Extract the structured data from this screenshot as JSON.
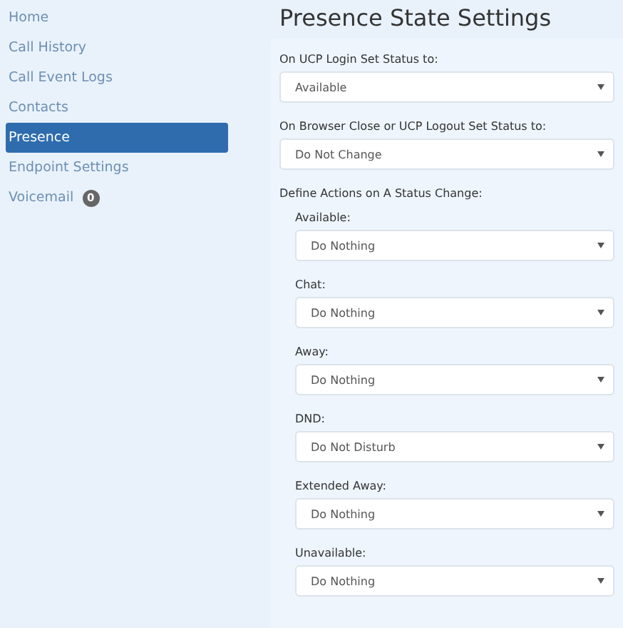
{
  "sidebar": {
    "items": [
      {
        "label": "Home",
        "selected": false
      },
      {
        "label": "Call History",
        "selected": false
      },
      {
        "label": "Call Event Logs",
        "selected": false
      },
      {
        "label": "Contacts",
        "selected": false
      },
      {
        "label": "Presence",
        "selected": true
      },
      {
        "label": "Endpoint Settings",
        "selected": false
      },
      {
        "label": "Voicemail",
        "selected": false,
        "badge": "0"
      }
    ]
  },
  "page_title": "Presence State Settings",
  "settings": [
    {
      "label": "On UCP Login Set Status to:",
      "value": "Available"
    },
    {
      "label": "On Browser Close or UCP Logout Set Status to:",
      "value": "Do Not Change"
    }
  ],
  "actions": {
    "heading": "Define Actions on A Status Change:",
    "items": [
      {
        "label": "Available:",
        "value": "Do Nothing"
      },
      {
        "label": "Chat:",
        "value": "Do Nothing"
      },
      {
        "label": "Away:",
        "value": "Do Nothing"
      },
      {
        "label": "DND:",
        "value": "Do Not Disturb"
      },
      {
        "label": "Extended Away:",
        "value": "Do Nothing"
      },
      {
        "label": "Unavailable:",
        "value": "Do Nothing"
      }
    ]
  }
}
